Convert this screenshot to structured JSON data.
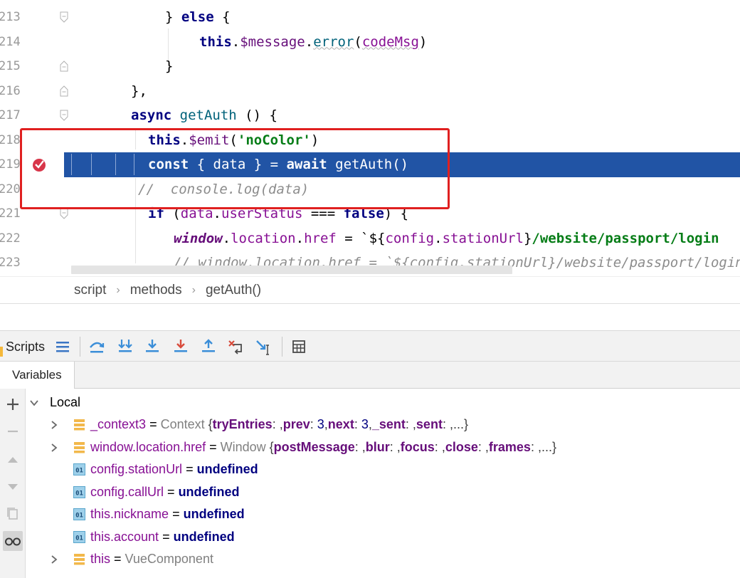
{
  "editor": {
    "lines": [
      {
        "num": "213",
        "tokens": [
          [
            "pn",
            "} "
          ],
          [
            "kw",
            "else"
          ],
          [
            "pn",
            " {"
          ]
        ]
      },
      {
        "num": "214",
        "tokens": [
          [
            "kw",
            "this"
          ],
          [
            "pn",
            "."
          ],
          [
            "prop",
            "$message"
          ],
          [
            "pn",
            "."
          ],
          [
            "fn",
            "error"
          ],
          [
            "pn",
            "("
          ],
          [
            "varc",
            "codeMsg"
          ],
          [
            "pn",
            ")"
          ]
        ]
      },
      {
        "num": "215",
        "tokens": [
          [
            "pn",
            "}"
          ]
        ]
      },
      {
        "num": "216",
        "tokens": [
          [
            "pn",
            "},"
          ]
        ]
      },
      {
        "num": "217",
        "tokens": [
          [
            "kw",
            "async "
          ],
          [
            "fn",
            "getAuth"
          ],
          [
            "pn",
            " () {"
          ]
        ]
      },
      {
        "num": "218",
        "tokens": [
          [
            "kw",
            "this"
          ],
          [
            "pn",
            "."
          ],
          [
            "prop",
            "$emit"
          ],
          [
            "pn",
            "("
          ],
          [
            "str",
            "'noColor'"
          ],
          [
            "pn",
            ")"
          ]
        ]
      },
      {
        "num": "219",
        "tokens": [
          [
            "kw",
            "const"
          ],
          [
            "pn",
            " { data } = "
          ],
          [
            "kw",
            "await "
          ],
          [
            "fnb",
            "getAuth"
          ],
          [
            "pn",
            "()"
          ]
        ]
      },
      {
        "num": "220",
        "tokens": [
          [
            "cmt",
            "//  console.log(data)"
          ]
        ]
      },
      {
        "num": "221",
        "tokens": [
          [
            "kw",
            "if"
          ],
          [
            "pn",
            " ("
          ],
          [
            "varc",
            "data"
          ],
          [
            "pn",
            "."
          ],
          [
            "varc",
            "userStatus"
          ],
          [
            "pn",
            " === "
          ],
          [
            "kw",
            "false"
          ],
          [
            "pn",
            ") {"
          ]
        ]
      },
      {
        "num": "222",
        "tokens": [
          [
            "glob",
            "window"
          ],
          [
            "pn",
            "."
          ],
          [
            "varc",
            "location"
          ],
          [
            "pn",
            "."
          ],
          [
            "varc",
            "href"
          ],
          [
            "pn",
            " = `${"
          ],
          [
            "varc",
            "config"
          ],
          [
            "pn",
            "."
          ],
          [
            "varc",
            "stationUrl"
          ],
          [
            "pn",
            "}"
          ],
          [
            "str",
            "/website/passport/login"
          ]
        ]
      },
      {
        "num": "223",
        "tokens": [
          [
            "cmt",
            "// window.location.href = `${config.stationUrl}/website/passport/login"
          ]
        ]
      }
    ]
  },
  "breadcrumb": [
    "script",
    "methods",
    "getAuth()"
  ],
  "debugger": {
    "panel_label": "Scripts",
    "tab_label": "Variables"
  },
  "variables": {
    "scope": "Local",
    "rows": [
      {
        "name": "_context3",
        "eq": " = ",
        "type": "Context ",
        "obj": [
          [
            "tryEntries",
            ""
          ],
          [
            "prev",
            "3"
          ],
          [
            "next",
            "3"
          ],
          [
            "_sent",
            ""
          ],
          [
            "sent",
            ""
          ]
        ],
        "tail": ",...}",
        "expandable": true,
        "icon": "field-icon"
      },
      {
        "name": "window.location.href",
        "eq": " = ",
        "type": "Window ",
        "obj": [
          [
            "postMessage",
            ""
          ],
          [
            "blur",
            ""
          ],
          [
            "focus",
            ""
          ],
          [
            "close",
            ""
          ],
          [
            "frames",
            ""
          ]
        ],
        "tail": ",...}",
        "expandable": true,
        "icon": "field-icon"
      },
      {
        "name": "config.stationUrl",
        "eq": " = ",
        "value": "undefined",
        "expandable": false,
        "icon": "primitive-icon"
      },
      {
        "name": "config.callUrl",
        "eq": " = ",
        "value": "undefined",
        "expandable": false,
        "icon": "primitive-icon"
      },
      {
        "name": "this.nickname",
        "eq": " = ",
        "value": "undefined",
        "expandable": false,
        "icon": "primitive-icon"
      },
      {
        "name": "this.account",
        "eq": " = ",
        "value": "undefined",
        "expandable": false,
        "icon": "primitive-icon"
      },
      {
        "name": "this",
        "eq": " = ",
        "type": "VueComponent",
        "expandable": true,
        "icon": "field-icon"
      }
    ]
  },
  "colors": {
    "current_line": "#2154a5",
    "highlight_box": "#e02020",
    "breakpoint": "#d8364a"
  }
}
